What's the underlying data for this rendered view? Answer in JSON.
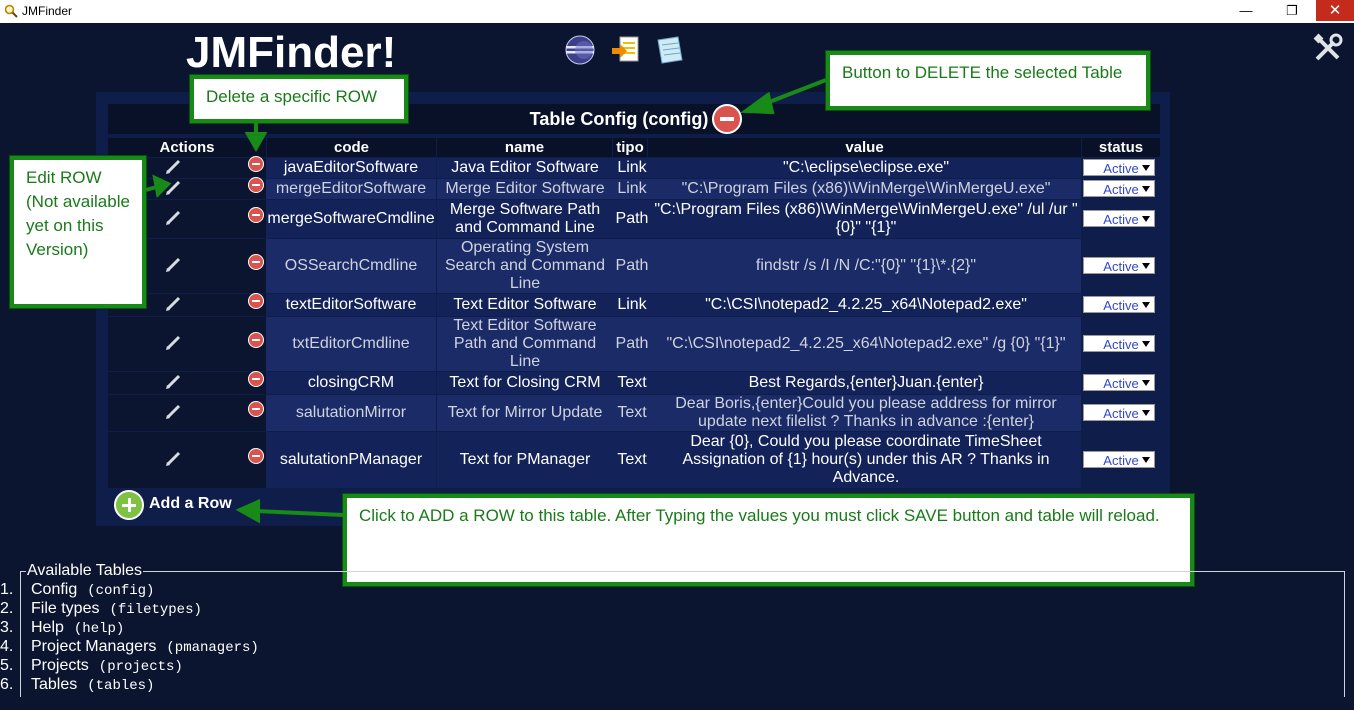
{
  "window": {
    "title": "JMFinder",
    "min": "—",
    "max": "❐",
    "close": "✕"
  },
  "header": {
    "logo": "JMFinder!",
    "icons": [
      "eclipse-icon",
      "merge-icon",
      "notepad-icon"
    ],
    "settings_icon": "tools-icon"
  },
  "table": {
    "title": "Table Config (config)",
    "columns": [
      "Actions",
      "code",
      "name",
      "tipo",
      "value",
      "status"
    ],
    "rows": [
      {
        "code": "javaEditorSoftware",
        "name": "Java Editor Software",
        "tipo": "Link",
        "value": "\"C:\\eclipse\\eclipse.exe\"",
        "status": "Active"
      },
      {
        "code": "mergeEditorSoftware",
        "name": "Merge Editor Software",
        "tipo": "Link",
        "value": "\"C:\\Program Files (x86)\\WinMerge\\WinMergeU.exe\"",
        "status": "Active"
      },
      {
        "code": "mergeSoftwareCmdline",
        "name": "Merge Software Path and Command Line",
        "tipo": "Path",
        "value": "\"C:\\Program Files (x86)\\WinMerge\\WinMergeU.exe\" /ul /ur \"{0}\" \"{1}\"",
        "status": "Active"
      },
      {
        "code": "OSSearchCmdline",
        "name": "Operating System Search and Command Line",
        "tipo": "Path",
        "value": "findstr /s /I /N /C:\"{0}\" \"{1}\\*.{2}\"",
        "status": "Active"
      },
      {
        "code": "textEditorSoftware",
        "name": "Text Editor Software",
        "tipo": "Link",
        "value": "\"C:\\CSI\\notepad2_4.2.25_x64\\Notepad2.exe\"",
        "status": "Active"
      },
      {
        "code": "txtEditorCmdline",
        "name": "Text Editor Software Path and Command Line",
        "tipo": "Path",
        "value": "\"C:\\CSI\\notepad2_4.2.25_x64\\Notepad2.exe\" /g {0} \"{1}\"",
        "status": "Active"
      },
      {
        "code": "closingCRM",
        "name": "Text for Closing CRM",
        "tipo": "Text",
        "value": "Best Regards,{enter}Juan.{enter}",
        "status": "Active"
      },
      {
        "code": "salutationMirror",
        "name": "Text for Mirror Update",
        "tipo": "Text",
        "value": "Dear Boris,{enter}Could you please address for mirror update next filelist ? Thanks in advance :{enter}",
        "status": "Active"
      },
      {
        "code": "salutationPManager",
        "name": "Text for PManager",
        "tipo": "Text",
        "value": "Dear {0}, Could you please coordinate TimeSheet Assignation of {1} hour(s) under this AR ? Thanks in Advance.",
        "status": "Active"
      }
    ],
    "add_row_label": "Add a Row"
  },
  "callouts": {
    "delete_table": "Button to DELETE the selected Table",
    "delete_row": "Delete a specific ROW",
    "edit_row": "Edit ROW (Not available yet on this Version)",
    "add_row": "Click to ADD a ROW to this table. After Typing the values you must click SAVE button and table will reload."
  },
  "available_tables": {
    "legend": "Available Tables",
    "items": [
      {
        "num": "1.",
        "name": "Config",
        "code": "(config)"
      },
      {
        "num": "2.",
        "name": "File types",
        "code": "(filetypes)"
      },
      {
        "num": "3.",
        "name": "Help",
        "code": "(help)"
      },
      {
        "num": "4.",
        "name": "Project Managers",
        "code": "(pmanagers)"
      },
      {
        "num": "5.",
        "name": "Projects",
        "code": "(projects)"
      },
      {
        "num": "6.",
        "name": "Tables",
        "code": "(tables)"
      }
    ]
  },
  "colors": {
    "background": "#0b1530",
    "panel": "#0f1d4a",
    "callout_border": "#178a17",
    "callout_text": "#1a7a1a",
    "delete_red": "#d9534f",
    "add_green": "#7dc242"
  }
}
